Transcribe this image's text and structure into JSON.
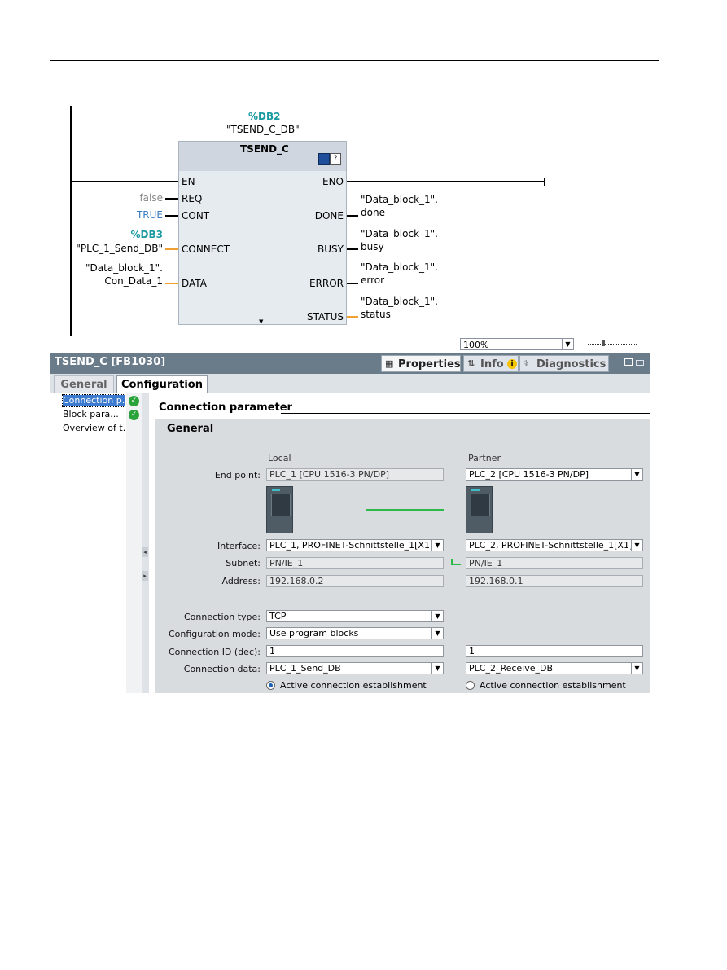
{
  "ladder": {
    "instance_db": "%DB2",
    "instance_name": "\"TSEND_C_DB\"",
    "block_name": "TSEND_C",
    "inputs": [
      {
        "pin": "EN",
        "value": ""
      },
      {
        "pin": "REQ",
        "value": "false"
      },
      {
        "pin": "CONT",
        "value": "TRUE"
      },
      {
        "pin": "CONNECT",
        "db": "%DB3",
        "value": "\"PLC_1_Send_DB\""
      },
      {
        "pin": "DATA",
        "value_line1": "\"Data_block_1\".",
        "value_line2": "Con_Data_1"
      }
    ],
    "outputs": [
      {
        "pin": "ENO"
      },
      {
        "pin": "DONE",
        "line1": "\"Data_block_1\".",
        "line2": "done"
      },
      {
        "pin": "BUSY",
        "line1": "\"Data_block_1\".",
        "line2": "busy"
      },
      {
        "pin": "ERROR",
        "line1": "\"Data_block_1\".",
        "line2": "error"
      },
      {
        "pin": "STATUS",
        "line1": "\"Data_block_1\".",
        "line2": "status"
      }
    ]
  },
  "zoom": {
    "value": "100%"
  },
  "panel": {
    "title": "TSEND_C [FB1030]",
    "tabs": [
      {
        "label": "Properties",
        "icon": "properties-icon",
        "active": true
      },
      {
        "label": "Info",
        "icon": "info-icon",
        "active": false
      },
      {
        "label": "Diagnostics",
        "icon": "diagnostics-icon",
        "active": false
      }
    ],
    "subtabs": [
      {
        "label": "General",
        "active": false
      },
      {
        "label": "Configuration",
        "active": true
      }
    ],
    "nav": [
      {
        "label": "Connection p...",
        "selected": true,
        "ok": true
      },
      {
        "label": "Block para...",
        "selected": false,
        "ok": true
      },
      {
        "label": "Overview of t...",
        "selected": false,
        "ok": false
      }
    ],
    "section_title": "Connection parameter",
    "group_title": "General",
    "col_local": "Local",
    "col_partner": "Partner",
    "rows": {
      "end_point": {
        "label": "End point:",
        "local": "PLC_1 [CPU 1516-3 PN/DP]",
        "partner": "PLC_2 [CPU 1516-3 PN/DP]"
      },
      "interface": {
        "label": "Interface:",
        "local": "PLC_1, PROFINET-Schnittstelle_1[X1]",
        "partner": "PLC_2, PROFINET-Schnittstelle_1[X1]"
      },
      "subnet": {
        "label": "Subnet:",
        "local": "PN/IE_1",
        "partner": "PN/IE_1"
      },
      "address": {
        "label": "Address:",
        "local": "192.168.0.2",
        "partner": "192.168.0.1"
      },
      "connection_type": {
        "label": "Connection type:",
        "local": "TCP"
      },
      "configuration_mode": {
        "label": "Configuration mode:",
        "local": "Use program blocks"
      },
      "connection_id": {
        "label": "Connection ID (dec):",
        "local": "1",
        "partner": "1"
      },
      "connection_data": {
        "label": "Connection data:",
        "local": "PLC_1_Send_DB",
        "partner": "PLC_2_Receive_DB"
      },
      "active_establishment": {
        "local": "Active connection establishment",
        "local_checked": true,
        "partner": "Active connection establishment",
        "partner_checked": false
      }
    }
  },
  "colors": {
    "accent_teal": "#1a9aa0",
    "wire_orange": "#f0a030",
    "connection_green": "#2db84a",
    "title_bar": "#6a7b8a"
  }
}
